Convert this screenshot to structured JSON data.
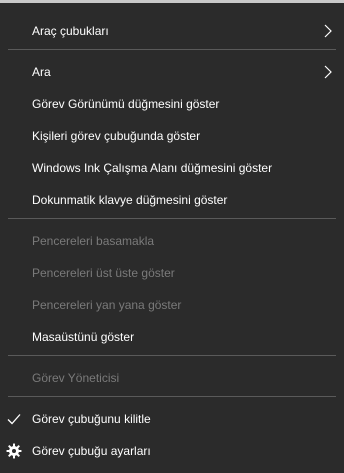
{
  "menu": {
    "items": [
      {
        "label": "Araç çubukları",
        "has_submenu": true
      },
      {
        "label": "Ara",
        "has_submenu": true
      },
      {
        "label": "Görev Görünümü düğmesini göster"
      },
      {
        "label": "Kişileri görev çubuğunda göster"
      },
      {
        "label": "Windows Ink Çalışma Alanı düğmesini göster"
      },
      {
        "label": "Dokunmatik klavye düğmesini göster"
      },
      {
        "label": "Pencereleri basamakla",
        "enabled": false
      },
      {
        "label": "Pencereleri üst üste göster",
        "enabled": false
      },
      {
        "label": "Pencereleri yan yana göster",
        "enabled": false
      },
      {
        "label": "Masaüstünü göster"
      },
      {
        "label": "Görev Yöneticisi",
        "enabled": false
      },
      {
        "label": "Görev çubuğunu kilitle",
        "checked": true,
        "icon": "checkmark-icon"
      },
      {
        "label": "Görev çubuğu ayarları",
        "icon": "gear-icon"
      }
    ]
  },
  "colors": {
    "background": "#2b2b2b",
    "text": "#ffffff",
    "disabled_text": "#7a7a7a",
    "separator": "#5a5a5a"
  }
}
